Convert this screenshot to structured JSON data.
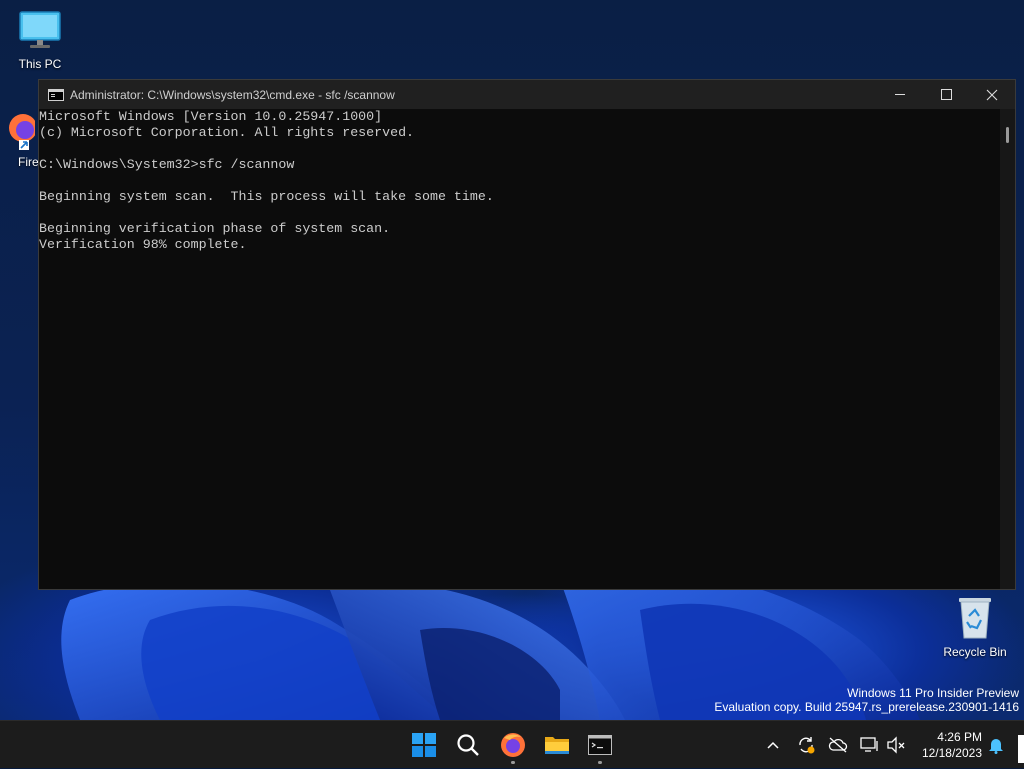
{
  "desktop": {
    "icons": [
      {
        "label": "This PC"
      },
      {
        "label": "Fire"
      },
      {
        "label": "Recycle Bin"
      }
    ],
    "watermark": {
      "line1": "Windows 11 Pro Insider Preview",
      "line2": "Evaluation copy. Build 25947.rs_prerelease.230901-1416"
    }
  },
  "window": {
    "title": "Administrator: C:\\Windows\\system32\\cmd.exe - sfc  /scannow",
    "console_lines": [
      "Microsoft Windows [Version 10.0.25947.1000]",
      "(c) Microsoft Corporation. All rights reserved.",
      "",
      "C:\\Windows\\System32>sfc /scannow",
      "",
      "Beginning system scan.  This process will take some time.",
      "",
      "Beginning verification phase of system scan.",
      "Verification 98% complete."
    ]
  },
  "taskbar": {
    "apps": [
      {
        "icon": "start-icon"
      },
      {
        "icon": "search-icon"
      },
      {
        "icon": "firefox-icon"
      },
      {
        "icon": "file-explorer-icon"
      },
      {
        "icon": "terminal-icon"
      }
    ],
    "clock": {
      "time": "4:26 PM",
      "date": "12/18/2023"
    }
  },
  "colors": {
    "console_bg": "#0c0c0c",
    "console_text": "#cccccc",
    "titlebar": "#202020",
    "taskbar": "#1c1c1c",
    "accent": "#0078d4"
  }
}
